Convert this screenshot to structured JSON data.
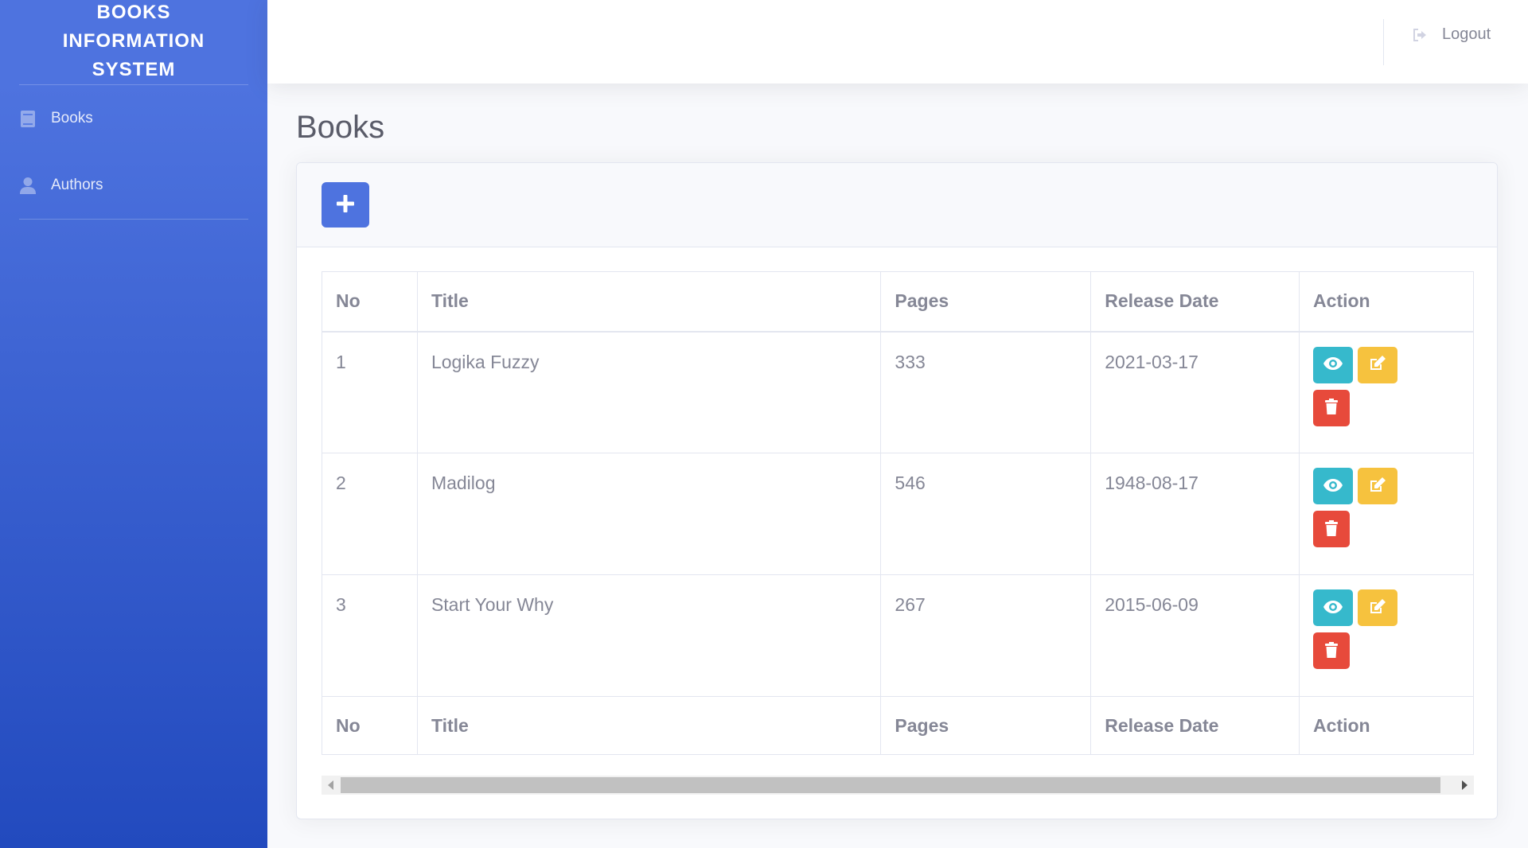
{
  "sidebar": {
    "brand": [
      "BOOKS",
      "INFORMATION",
      "SYSTEM"
    ],
    "items": [
      {
        "label": "Books",
        "icon": "book-icon"
      },
      {
        "label": "Authors",
        "icon": "user-icon"
      }
    ]
  },
  "topbar": {
    "logout_label": "Logout"
  },
  "main": {
    "title": "Books"
  },
  "table": {
    "headers": [
      "No",
      "Title",
      "Pages",
      "Release Date",
      "Action"
    ],
    "rows": [
      {
        "no": "1",
        "title": "Logika Fuzzy",
        "pages": "333",
        "release_date": "2021-03-17"
      },
      {
        "no": "2",
        "title": "Madilog",
        "pages": "546",
        "release_date": "1948-08-17"
      },
      {
        "no": "3",
        "title": "Start Your Why",
        "pages": "267",
        "release_date": "2015-06-09"
      }
    ]
  },
  "colors": {
    "primary": "#4e73df",
    "info": "#36b9cc",
    "warning": "#f6c23e",
    "danger": "#e74a3b"
  }
}
